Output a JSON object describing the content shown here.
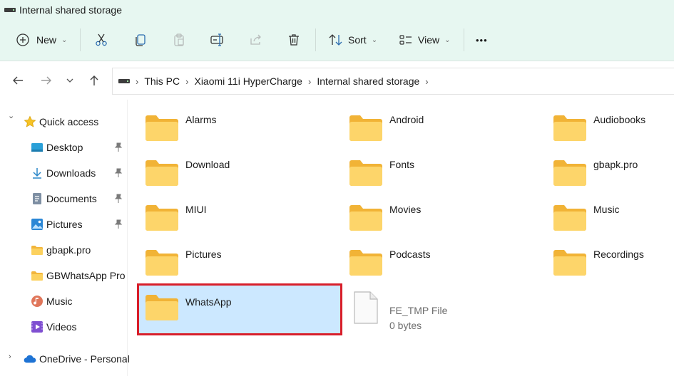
{
  "window": {
    "title": "Internal shared storage"
  },
  "toolbar": {
    "new_label": "New",
    "sort_label": "Sort",
    "view_label": "View",
    "more_label": "•••",
    "caret": "⌄"
  },
  "address": {
    "crumbs": [
      "This PC",
      "Xiaomi 11i HyperCharge",
      "Internal shared storage"
    ],
    "sep": "›"
  },
  "sidebar": {
    "quick_access": "Quick access",
    "items": [
      {
        "label": "Desktop",
        "icon": "desktop-icon",
        "pinned": true
      },
      {
        "label": "Downloads",
        "icon": "download-icon",
        "pinned": true
      },
      {
        "label": "Documents",
        "icon": "documents-icon",
        "pinned": true
      },
      {
        "label": "Pictures",
        "icon": "pictures-icon",
        "pinned": true
      },
      {
        "label": "gbapk.pro",
        "icon": "folder-icon",
        "pinned": false
      },
      {
        "label": "GBWhatsApp Pro",
        "icon": "folder-icon",
        "pinned": false
      },
      {
        "label": "Music",
        "icon": "music-icon",
        "pinned": false
      },
      {
        "label": "Videos",
        "icon": "videos-icon",
        "pinned": false
      }
    ],
    "onedrive": "OneDrive - Personal",
    "expander_open": "⌄",
    "expander_closed": "›"
  },
  "content": {
    "folders": [
      "Alarms",
      "Android",
      "Audiobooks",
      "Download",
      "Fonts",
      "gbapk.pro",
      "MIUI",
      "Movies",
      "Music",
      "Pictures",
      "Podcasts",
      "Recordings",
      "WhatsApp"
    ],
    "file": {
      "name": "FE_TMP File",
      "size": "0 bytes"
    },
    "selected": "WhatsApp"
  },
  "colors": {
    "accent_bar": "#e7f7f1",
    "selection": "#cce8ff",
    "highlight_border": "#d81e2a",
    "folder": "#fcd15e"
  }
}
